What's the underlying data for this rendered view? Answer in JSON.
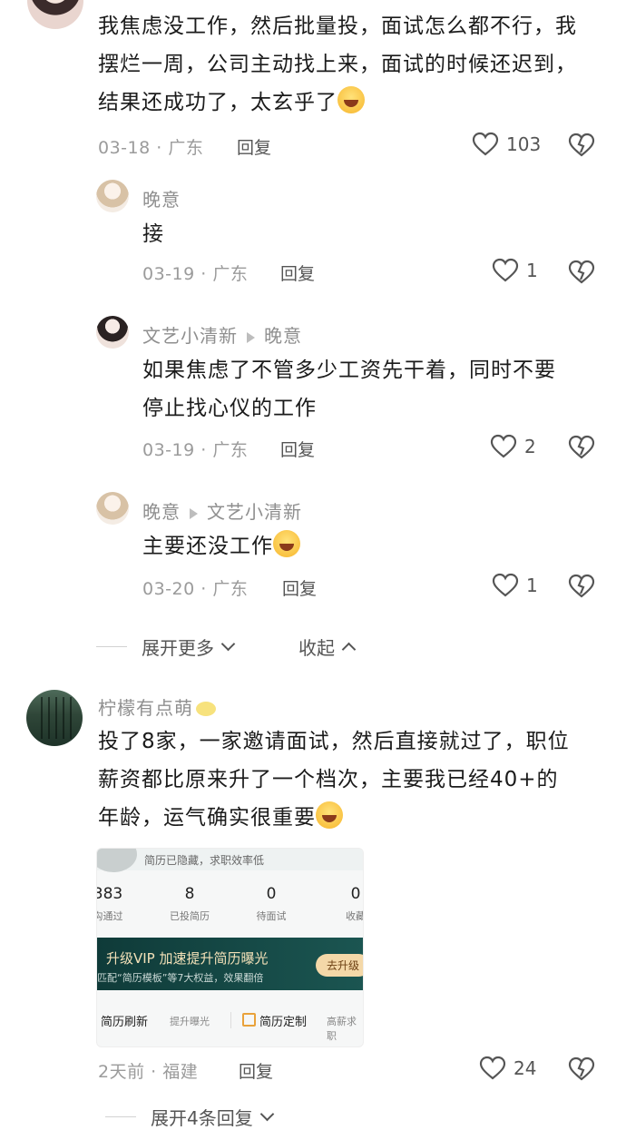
{
  "comments": [
    {
      "text_lines": [
        "我焦虑没工作，然后批量投，面试怎么都不行，我",
        "摆烂一周，公司主动找上来，面试的时候还迟到，",
        "结果还成功了，太玄乎了"
      ],
      "emoji": "crying-laughing-emoji",
      "date": "03-18",
      "dot": "·",
      "location": "广东",
      "reply": "回复",
      "likes": "103"
    },
    {
      "name": "晚意",
      "text": "接",
      "date": "03-19",
      "dot": "·",
      "location": "广东",
      "reply": "回复",
      "likes": "1"
    },
    {
      "name": "文艺小清新",
      "reply_to": "晚意",
      "text_lines": [
        "如果焦虑了不管多少工资先干着，同时不要",
        "停止找心仪的工作"
      ],
      "date": "03-19",
      "dot": "·",
      "location": "广东",
      "reply": "回复",
      "likes": "2"
    },
    {
      "name": "晚意",
      "reply_to": "文艺小清新",
      "text": "主要还没工作",
      "emoji": "crying-laughing-emoji",
      "date": "03-20",
      "dot": "·",
      "location": "广东",
      "reply": "回复",
      "likes": "1"
    },
    {
      "name": "柠檬有点萌",
      "text_lines": [
        "投了8家，一家邀请面试，然后直接就过了，职位",
        "薪资都比原来升了一个档次，主要我已经40+的",
        "年龄，运气确实很重要"
      ],
      "date": "2天前",
      "dot": "·",
      "location": "福建",
      "reply": "回复",
      "likes": "24"
    }
  ],
  "thread_controls": {
    "expand_more": "展开更多",
    "collapse": "收起",
    "expand_replies": "展开4条回复"
  },
  "image_card": {
    "top_text": "简历已隐藏，求职效率低",
    "stats": [
      {
        "value": "383",
        "label": "沟通过"
      },
      {
        "value": "8",
        "label": "已投简历"
      },
      {
        "value": "0",
        "label": "待面试"
      },
      {
        "value": "0",
        "label": "收藏"
      }
    ],
    "vip_title": "升级VIP  加速提升简历曝光",
    "vip_sub": "匹配“简历模板”等7大权益，效果翻倍",
    "vip_button": "去升级",
    "bottom_items": [
      "简历刷新",
      "提升曝光",
      "简历定制",
      "高薪求职"
    ]
  }
}
